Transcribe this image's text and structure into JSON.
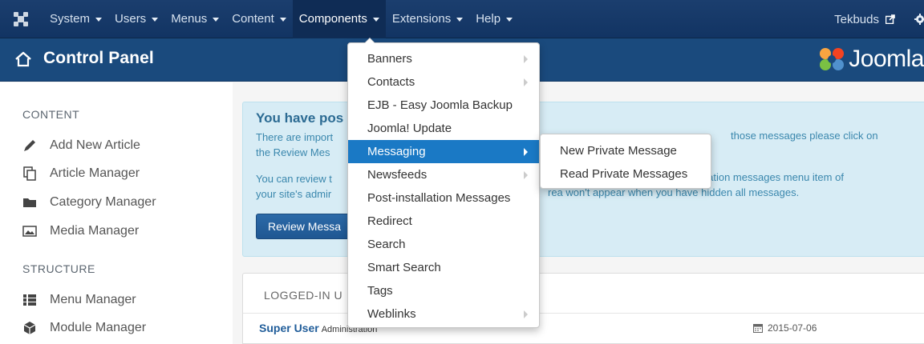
{
  "topbar": {
    "menus": [
      "System",
      "Users",
      "Menus",
      "Content",
      "Components",
      "Extensions",
      "Help"
    ],
    "active_menu": "Components",
    "site_name": "Tekbuds"
  },
  "titlebar": {
    "title": "Control Panel",
    "brand": "Joomla"
  },
  "sidebar": {
    "content_heading": "CONTENT",
    "content_items": [
      "Add New Article",
      "Article Manager",
      "Category Manager",
      "Media Manager"
    ],
    "structure_heading": "STRUCTURE",
    "structure_items": [
      "Menu Manager",
      "Module Manager"
    ]
  },
  "alert": {
    "title": "You have pos",
    "line1": "There are import",
    "line1_cont": "those messages please click on",
    "line2": "the Review Mes",
    "line3": "You can review t",
    "line3_cont": "stallation messages menu item of",
    "line4": "your site's admir",
    "line4_cont": "rea won't appear when you have hidden all messages.",
    "button": "Review Messa"
  },
  "panel": {
    "heading": "LOGGED-IN U",
    "user_name": "Super User",
    "user_role": "Administration",
    "date": "2015-07-06"
  },
  "components_menu": {
    "items": [
      {
        "label": "Banners",
        "has_sub": true
      },
      {
        "label": "Contacts",
        "has_sub": true
      },
      {
        "label": "EJB - Easy Joomla Backup",
        "has_sub": false
      },
      {
        "label": "Joomla! Update",
        "has_sub": false
      },
      {
        "label": "Messaging",
        "has_sub": true,
        "active": true
      },
      {
        "label": "Newsfeeds",
        "has_sub": true
      },
      {
        "label": "Post-installation Messages",
        "has_sub": false
      },
      {
        "label": "Redirect",
        "has_sub": false
      },
      {
        "label": "Search",
        "has_sub": false
      },
      {
        "label": "Smart Search",
        "has_sub": false
      },
      {
        "label": "Tags",
        "has_sub": false
      },
      {
        "label": "Weblinks",
        "has_sub": true
      }
    ],
    "submenu": [
      "New Private Message",
      "Read Private Messages"
    ]
  },
  "colors": {
    "topbar": "#1b3e6e",
    "titlebar": "#1a4a7d",
    "active_item": "#1a79c5",
    "alert_bg": "#d7ecf5",
    "alert_text": "#3a87ad"
  }
}
